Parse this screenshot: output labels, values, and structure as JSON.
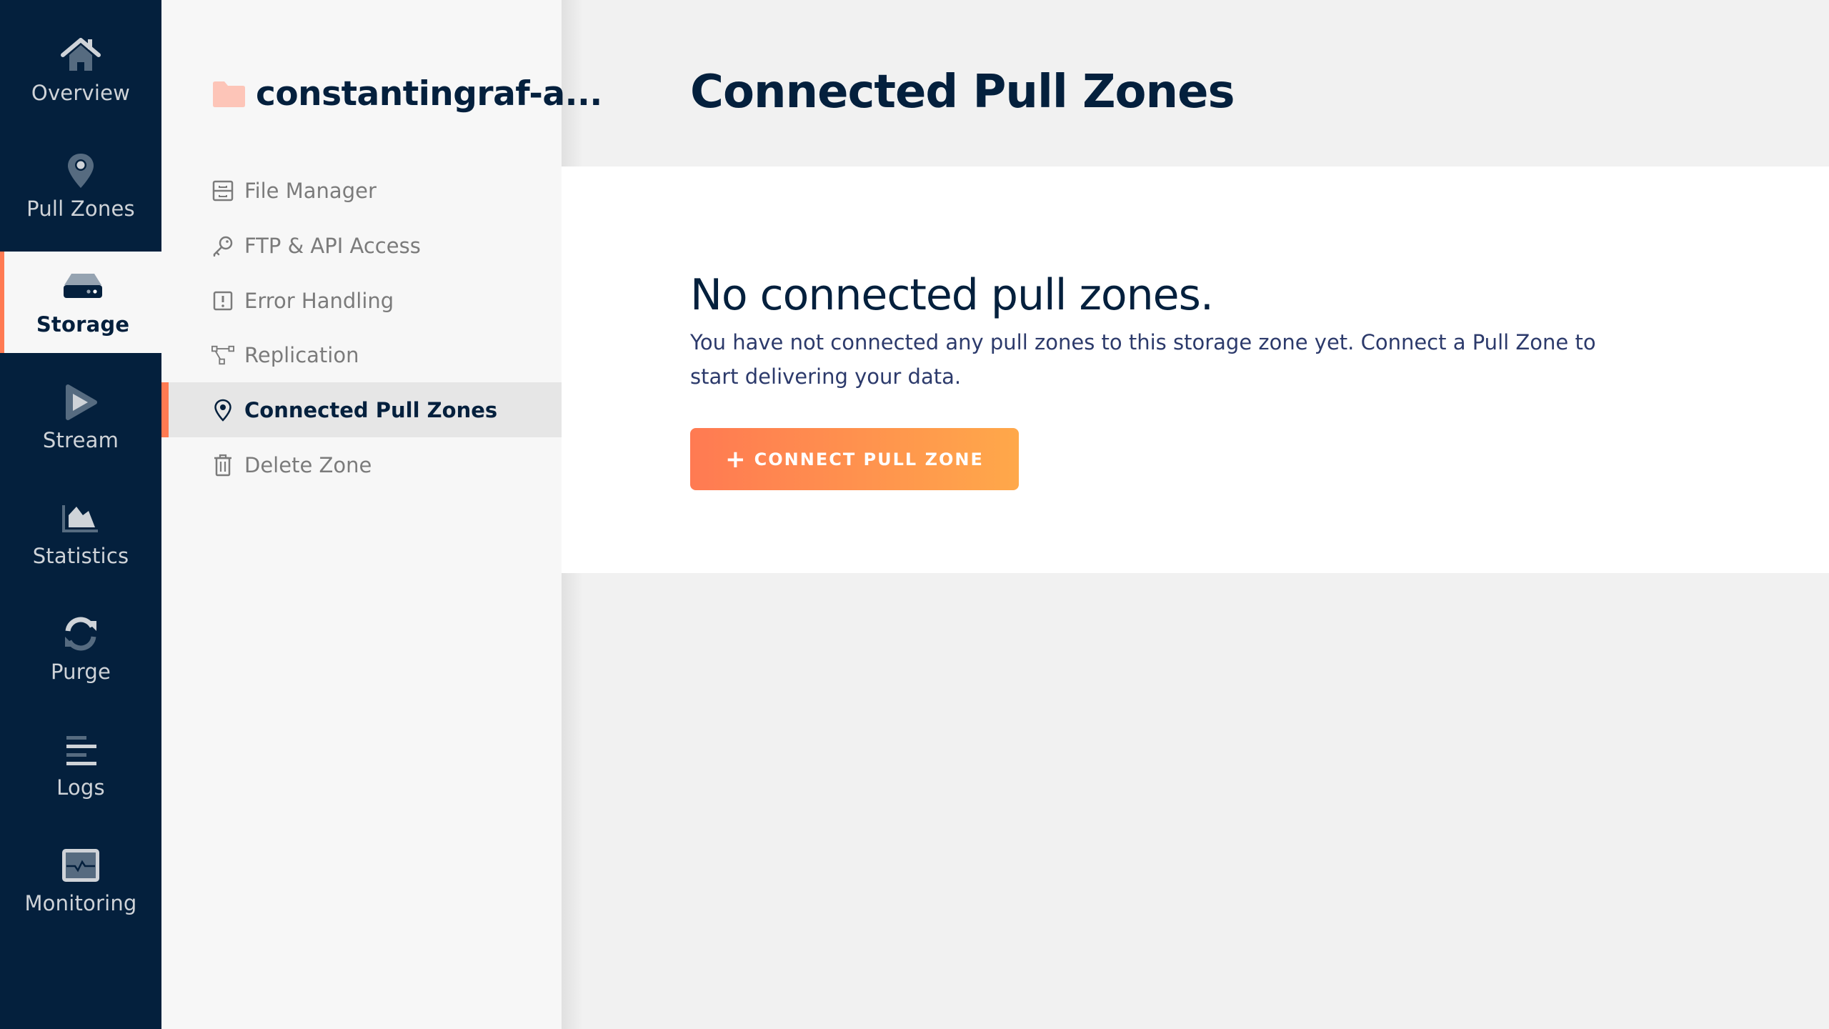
{
  "primary_nav": {
    "items": [
      {
        "label": "Overview",
        "icon": "home-icon",
        "active": false
      },
      {
        "label": "Pull Zones",
        "icon": "map-pin-icon",
        "active": false
      },
      {
        "label": "Storage",
        "icon": "storage-drive-icon",
        "active": true
      },
      {
        "label": "Stream",
        "icon": "play-icon",
        "active": false
      },
      {
        "label": "Statistics",
        "icon": "area-chart-icon",
        "active": false
      },
      {
        "label": "Purge",
        "icon": "refresh-icon",
        "active": false
      },
      {
        "label": "Logs",
        "icon": "lines-icon",
        "active": false
      },
      {
        "label": "Monitoring",
        "icon": "monitor-pulse-icon",
        "active": false
      }
    ]
  },
  "secondary_nav": {
    "zone_name": "constantingraf-a...",
    "zone_icon": "folder-icon",
    "items": [
      {
        "label": "File Manager",
        "icon": "file-cabinet-icon",
        "active": false
      },
      {
        "label": "FTP & API Access",
        "icon": "key-icon",
        "active": false
      },
      {
        "label": "Error Handling",
        "icon": "exclamation-box-icon",
        "active": false
      },
      {
        "label": "Replication",
        "icon": "network-nodes-icon",
        "active": false
      },
      {
        "label": "Connected Pull Zones",
        "icon": "map-pin-icon",
        "active": true
      },
      {
        "label": "Delete Zone",
        "icon": "trash-icon",
        "active": false
      }
    ]
  },
  "main": {
    "title": "Connected Pull Zones",
    "empty_state": {
      "title": "No connected pull zones.",
      "text": "You have not connected any pull zones to this storage zone yet. Connect a Pull Zone to start delivering your data.",
      "button_icon": "+",
      "button_label": "CONNECT PULL ZONE"
    }
  },
  "colors": {
    "nav_bg": "#04203d",
    "accent": "#ff7a52",
    "accent_end": "#ffa84a",
    "text_dark": "#04203d",
    "folder": "#fdc5b8"
  }
}
